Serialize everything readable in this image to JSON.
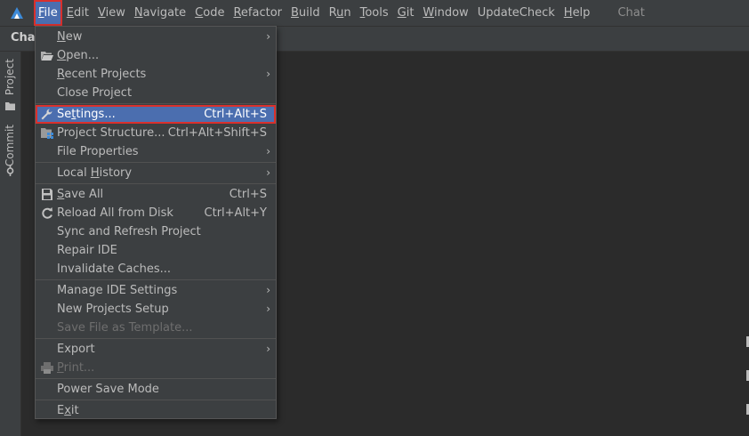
{
  "menubar": {
    "items": [
      {
        "pre": "",
        "u": "F",
        "post": "ile"
      },
      {
        "pre": "",
        "u": "E",
        "post": "dit"
      },
      {
        "pre": "",
        "u": "V",
        "post": "iew"
      },
      {
        "pre": "",
        "u": "N",
        "post": "avigate"
      },
      {
        "pre": "",
        "u": "C",
        "post": "ode"
      },
      {
        "pre": "",
        "u": "R",
        "post": "efactor"
      },
      {
        "pre": "",
        "u": "B",
        "post": "uild"
      },
      {
        "pre": "R",
        "u": "u",
        "post": "n"
      },
      {
        "pre": "",
        "u": "T",
        "post": "ools"
      },
      {
        "pre": "",
        "u": "G",
        "post": "it"
      },
      {
        "pre": "",
        "u": "W",
        "post": "indow"
      },
      {
        "pre": "UpdateCheck",
        "u": "",
        "post": ""
      },
      {
        "pre": "",
        "u": "H",
        "post": "elp"
      }
    ],
    "window_title": "Chat"
  },
  "toolbar": {
    "tab_label": "Chat"
  },
  "left_strip": {
    "project_label": "Project",
    "commit_label": "Commit"
  },
  "file_menu": {
    "rows": [
      {
        "pre": "",
        "u": "N",
        "post": "ew",
        "shortcut": "",
        "arrow": "›"
      },
      {
        "pre": "",
        "u": "O",
        "post": "pen...",
        "shortcut": "",
        "arrow": ""
      },
      {
        "pre": "",
        "u": "R",
        "post": "ecent Projects",
        "shortcut": "",
        "arrow": "›"
      },
      {
        "pre": "Close Pro",
        "u": "j",
        "post": "ect",
        "shortcut": "",
        "arrow": ""
      },
      {
        "pre": "Se",
        "u": "t",
        "post": "tings...",
        "shortcut": "Ctrl+Alt+S",
        "arrow": ""
      },
      {
        "pre": "Project Structure...",
        "u": "",
        "post": "",
        "shortcut": "Ctrl+Alt+Shift+S",
        "arrow": ""
      },
      {
        "pre": "File Properties",
        "u": "",
        "post": "",
        "shortcut": "",
        "arrow": "›"
      },
      {
        "pre": "Local ",
        "u": "H",
        "post": "istory",
        "shortcut": "",
        "arrow": "›"
      },
      {
        "pre": "",
        "u": "S",
        "post": "ave All",
        "shortcut": "Ctrl+S",
        "arrow": ""
      },
      {
        "pre": "Reload All from Disk",
        "u": "",
        "post": "",
        "shortcut": "Ctrl+Alt+Y",
        "arrow": ""
      },
      {
        "pre": "Sync and Refresh Project",
        "u": "",
        "post": "",
        "shortcut": "",
        "arrow": ""
      },
      {
        "pre": "Repair IDE",
        "u": "",
        "post": "",
        "shortcut": "",
        "arrow": ""
      },
      {
        "pre": "Invalidate Caches...",
        "u": "",
        "post": "",
        "shortcut": "",
        "arrow": ""
      },
      {
        "pre": "Manage IDE Settings",
        "u": "",
        "post": "",
        "shortcut": "",
        "arrow": "›"
      },
      {
        "pre": "New Projects Setup",
        "u": "",
        "post": "",
        "shortcut": "",
        "arrow": "›"
      },
      {
        "pre": "Save File as Template...",
        "u": "",
        "post": "",
        "shortcut": "",
        "arrow": ""
      },
      {
        "pre": "Export",
        "u": "",
        "post": "",
        "shortcut": "",
        "arrow": "›"
      },
      {
        "pre": "",
        "u": "P",
        "post": "rint...",
        "shortcut": "",
        "arrow": ""
      },
      {
        "pre": "Power Save Mode",
        "u": "",
        "post": "",
        "shortcut": "",
        "arrow": ""
      },
      {
        "pre": "E",
        "u": "x",
        "post": "it",
        "shortcut": "",
        "arrow": ""
      }
    ]
  },
  "icons": {
    "app_logo": "deveco-logo-icon",
    "open": "folder-open-icon",
    "settings": "wrench-icon",
    "project_structure": "project-structure-icon",
    "save_all": "save-icon",
    "reload": "reload-icon",
    "print": "printer-icon",
    "project": "folder-icon",
    "commit": "commit-icon"
  },
  "colors": {
    "selection": "#4b6eaf",
    "highlight_border": "#d9302c",
    "menu_bg": "#3c3f41"
  }
}
